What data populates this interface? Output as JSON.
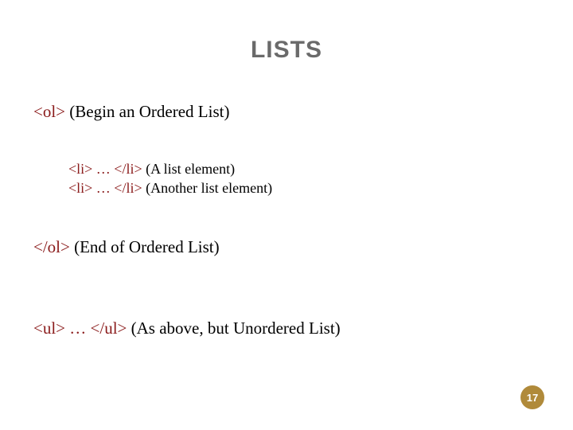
{
  "title": "LISTS",
  "lines": {
    "ol_open_tag": "<ol>",
    "ol_open_desc": " (Begin an Ordered List)",
    "li1_tag": "<li> … </li>",
    "li1_desc": " (A list element)",
    "li2_tag": "<li> … </li>",
    "li2_desc": " (Another list element)",
    "ol_close_tag": "</ol>",
    "ol_close_desc": " (End of Ordered List)",
    "ul_tag": "<ul> … </ul>",
    "ul_desc": " (As above, but Unordered List)"
  },
  "page_number": "17",
  "colors": {
    "title": "#6a6a6a",
    "tag": "#8a1a1a",
    "badge_bg": "#b08a3a"
  }
}
